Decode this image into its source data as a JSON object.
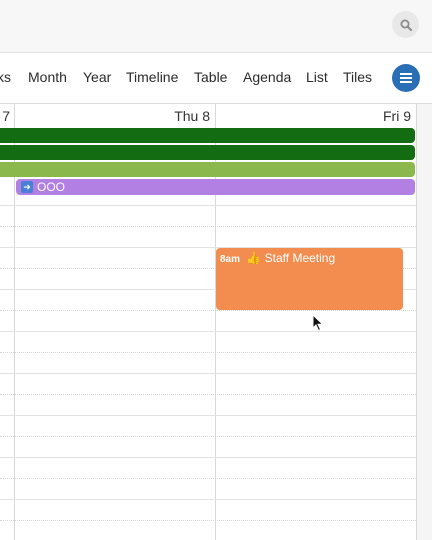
{
  "views": [
    "ks",
    "Month",
    "Year",
    "Timeline",
    "Table",
    "Agenda",
    "List",
    "Tiles"
  ],
  "days": [
    "7",
    "Thu 8",
    "Fri 9"
  ],
  "allday_events": [
    {
      "color": "#136b12"
    },
    {
      "color": "#136b12"
    },
    {
      "color": "#8bb84c"
    }
  ],
  "ooo_event": {
    "label": "OOO",
    "color": "#b280e3"
  },
  "event": {
    "time": "8am",
    "emoji": "👍",
    "title": "Staff Meeting",
    "color": "#f28d4f"
  },
  "icons": {
    "search": "search-icon",
    "menu": "menu-icon",
    "arrow": "arrow-right-icon",
    "cursor": "mouse-cursor-icon"
  },
  "accent": "#2a6fb5"
}
